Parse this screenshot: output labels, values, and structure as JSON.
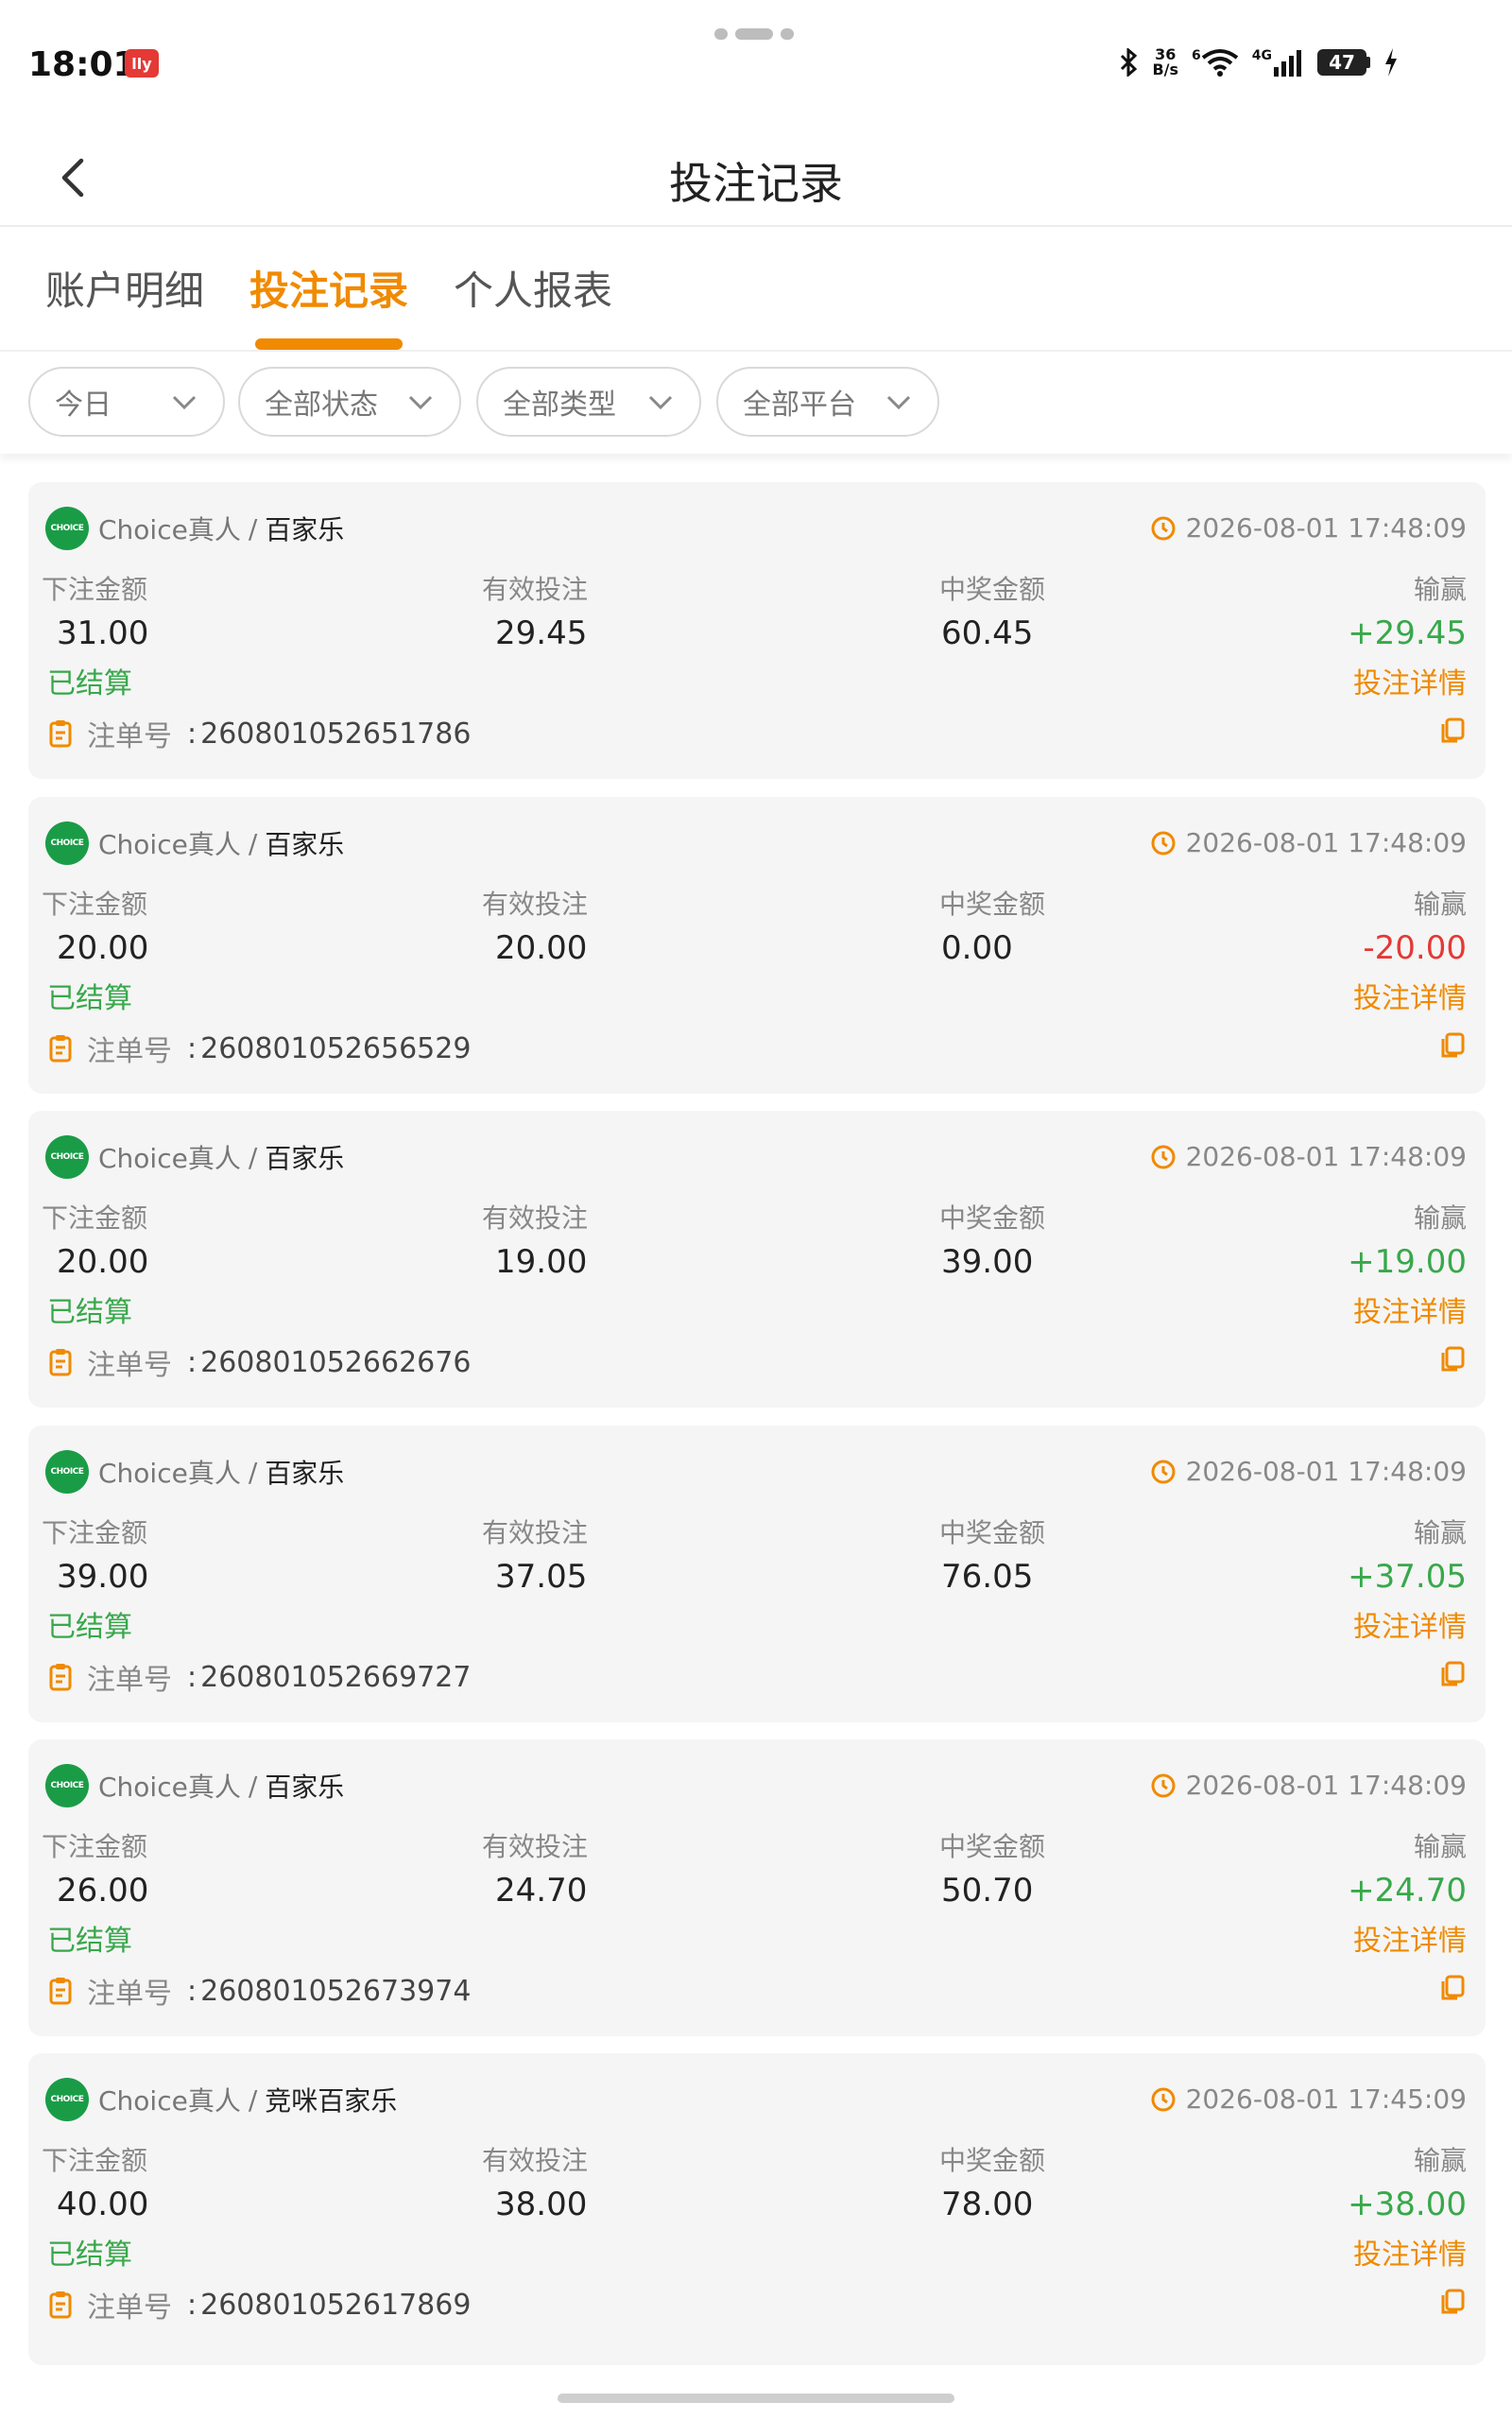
{
  "status_bar": {
    "time": "18:01",
    "app_badge": "lly",
    "net_speed_top": "36",
    "net_speed_bottom": "B/s",
    "wifi_label": "6",
    "signal_label": "4G",
    "battery": "47"
  },
  "header": {
    "title": "投注记录"
  },
  "tabs": [
    {
      "label": "账户明细",
      "active": false
    },
    {
      "label": "投注记录",
      "active": true
    },
    {
      "label": "个人报表",
      "active": false
    }
  ],
  "filters": [
    {
      "label": "今日"
    },
    {
      "label": "全部状态"
    },
    {
      "label": "全部类型"
    },
    {
      "label": "全部平台"
    }
  ],
  "column_labels": {
    "bet_amount": "下注金额",
    "valid_bet": "有效投注",
    "win_amount": "中奖金额",
    "profit": "输赢",
    "order_label": "注单号",
    "detail_link": "投注详情"
  },
  "brand_logo_text": "CHOICE",
  "records": [
    {
      "platform": "Choice真人",
      "game": "百家乐",
      "time": "2026-08-01 17:48:09",
      "bet": "31.00",
      "valid": "29.45",
      "win": "60.45",
      "profit": "+29.45",
      "profit_sign": "positive",
      "status": "已结算",
      "order_no": "260801052651786"
    },
    {
      "platform": "Choice真人",
      "game": "百家乐",
      "time": "2026-08-01 17:48:09",
      "bet": "20.00",
      "valid": "20.00",
      "win": "0.00",
      "profit": "-20.00",
      "profit_sign": "negative",
      "status": "已结算",
      "order_no": "260801052656529"
    },
    {
      "platform": "Choice真人",
      "game": "百家乐",
      "time": "2026-08-01 17:48:09",
      "bet": "20.00",
      "valid": "19.00",
      "win": "39.00",
      "profit": "+19.00",
      "profit_sign": "positive",
      "status": "已结算",
      "order_no": "260801052662676"
    },
    {
      "platform": "Choice真人",
      "game": "百家乐",
      "time": "2026-08-01 17:48:09",
      "bet": "39.00",
      "valid": "37.05",
      "win": "76.05",
      "profit": "+37.05",
      "profit_sign": "positive",
      "status": "已结算",
      "order_no": "260801052669727"
    },
    {
      "platform": "Choice真人",
      "game": "百家乐",
      "time": "2026-08-01 17:48:09",
      "bet": "26.00",
      "valid": "24.70",
      "win": "50.70",
      "profit": "+24.70",
      "profit_sign": "positive",
      "status": "已结算",
      "order_no": "260801052673974"
    },
    {
      "platform": "Choice真人",
      "game": "竞咪百家乐",
      "time": "2026-08-01 17:45:09",
      "bet": "40.00",
      "valid": "38.00",
      "win": "78.00",
      "profit": "+38.00",
      "profit_sign": "positive",
      "status": "已结算",
      "order_no": "260801052617869"
    }
  ],
  "colors": {
    "accent": "#f08a00",
    "positive": "#38a84b",
    "negative": "#e53935",
    "brand_green": "#1a9c47"
  }
}
